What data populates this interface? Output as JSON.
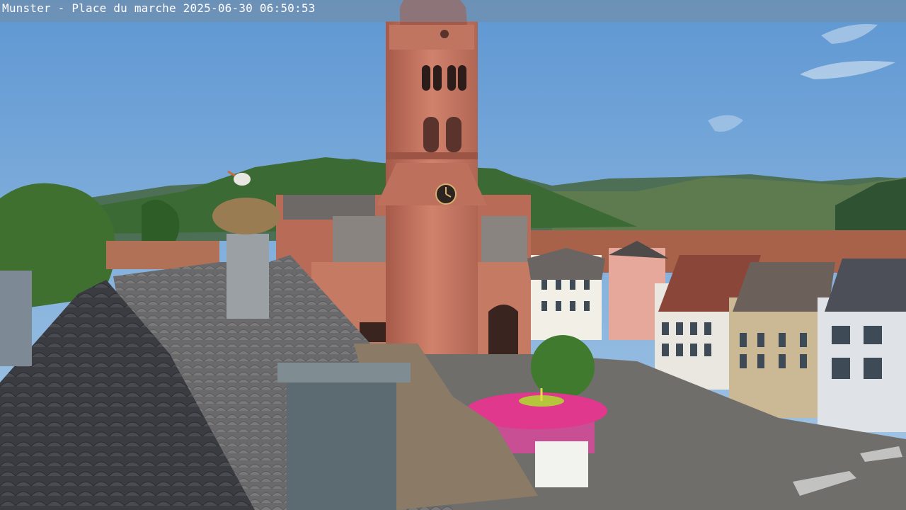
{
  "camera_overlay": {
    "location": "Munster - Place du marche",
    "timestamp": "2025-06-30 06:50:53"
  },
  "scene": {
    "subjects": [
      "church-tower",
      "church",
      "stork-nest",
      "slate-roof",
      "chimney",
      "market-square",
      "pink-carousel",
      "townhouses",
      "forested-hills",
      "sky"
    ],
    "clock_icon": "clock-face-icon"
  }
}
